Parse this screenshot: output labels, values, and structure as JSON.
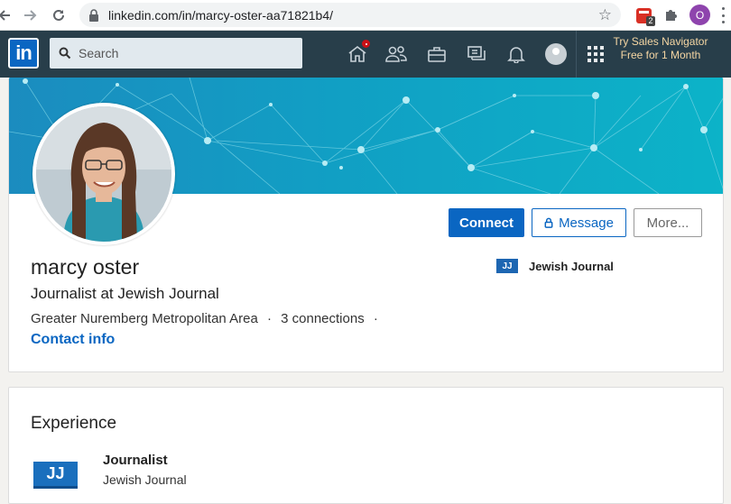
{
  "browser": {
    "url": "linkedin.com/in/marcy-oster-aa71821b4/",
    "extension_badge": "2",
    "profile_initial": "O"
  },
  "nav": {
    "logo": "in",
    "search_placeholder": "Search",
    "sales_promo": "Try Sales Navigator Free for 1 Month",
    "icons": [
      "home-icon",
      "my-network-icon",
      "jobs-icon",
      "messaging-icon",
      "notifications-icon",
      "me-avatar",
      "work-grid-icon"
    ]
  },
  "profile": {
    "name": "marcy oster",
    "headline": "Journalist at Jewish Journal",
    "location": "Greater Nuremberg Metropolitan Area",
    "separator": "·",
    "connections": "3 connections",
    "contact_info": "Contact info",
    "current_company": "Jewish Journal",
    "company_logo_text": "JJ"
  },
  "actions": {
    "connect": "Connect",
    "message": "Message",
    "more": "More..."
  },
  "experience": {
    "heading": "Experience",
    "items": [
      {
        "title": "Journalist",
        "company": "Jewish Journal",
        "logo_text": "JJ"
      }
    ]
  },
  "colors": {
    "linkedin_blue": "#0a66c2",
    "nav_bg": "#283e4a",
    "banner_start": "#1b8cbf",
    "banner_end": "#0cb3c8"
  }
}
